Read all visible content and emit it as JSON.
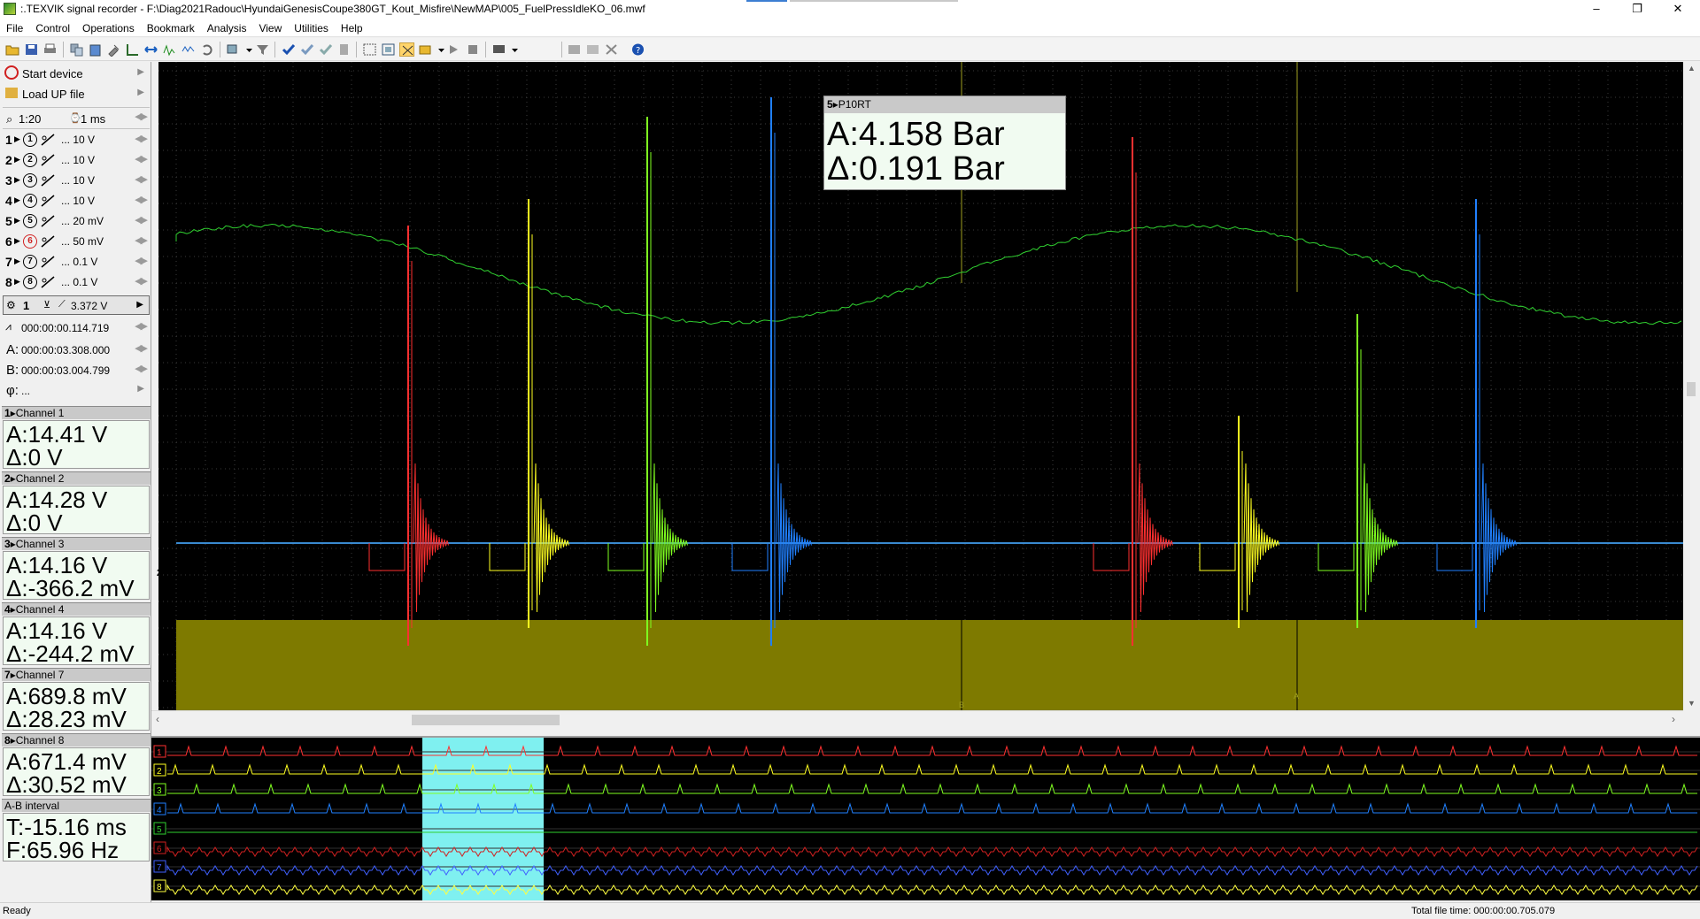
{
  "window": {
    "title": ":.TEXVIK  signal recorder - F:\\Diag2021Radouc\\HyundaiGenesisCoupe380GT_Kout_Misfire\\NewMAP\\005_FuelPressIdleKO_06.mwf",
    "minimize": "–",
    "restore": "❐",
    "close": "✕"
  },
  "menu": [
    "File",
    "Control",
    "Operations",
    "Bookmark",
    "Analysis",
    "View",
    "Utilities",
    "Help"
  ],
  "left": {
    "start_device": "Start device",
    "load_up_file": "Load UP file",
    "zoom": "1:20",
    "timebase": "1 ms",
    "channels": [
      {
        "num": "1",
        "circle": "1",
        "range": "... 10 V",
        "disabled": false
      },
      {
        "num": "2",
        "circle": "2",
        "range": "... 10 V",
        "disabled": false
      },
      {
        "num": "3",
        "circle": "3",
        "range": "... 10 V",
        "disabled": false
      },
      {
        "num": "4",
        "circle": "4",
        "range": "... 10 V",
        "disabled": false
      },
      {
        "num": "5",
        "circle": "5",
        "range": "... 20 mV",
        "disabled": false
      },
      {
        "num": "6",
        "circle": "6",
        "range": "... 50 mV",
        "disabled": true
      },
      {
        "num": "7",
        "circle": "7",
        "range": "... 0.1 V",
        "disabled": false
      },
      {
        "num": "8",
        "circle": "8",
        "range": "... 0.1 V",
        "disabled": false
      }
    ],
    "trigger": {
      "channel": "1",
      "level": "3.372 V"
    },
    "pretrigger": "000:00:00.114.719",
    "cursor_a_label": "A:",
    "cursor_a": "000:00:03.308.000",
    "cursor_b_label": "B:",
    "cursor_b": "000:00:03.004.799",
    "phi_label": "φ:",
    "phi": "..."
  },
  "panels": [
    {
      "num": "1",
      "name": "Channel 1",
      "a": "A:14.41 V",
      "d": "Δ:0 V"
    },
    {
      "num": "2",
      "name": "Channel 2",
      "a": "A:14.28 V",
      "d": "Δ:0 V"
    },
    {
      "num": "3",
      "name": "Channel 3",
      "a": "A:14.16 V",
      "d": "Δ:-366.2 mV"
    },
    {
      "num": "4",
      "name": "Channel 4",
      "a": "A:14.16 V",
      "d": "Δ:-244.2 mV"
    },
    {
      "num": "7",
      "name": "Channel 7",
      "a": "A:689.8 mV",
      "d": "Δ:28.23 mV"
    },
    {
      "num": "8",
      "name": "Channel 8",
      "a": "A:671.4 mV",
      "d": "Δ:30.52 mV"
    },
    {
      "num": "",
      "name": "A-B interval",
      "a": "T:-15.16 ms",
      "d": "F:65.96 Hz"
    }
  ],
  "tooltip": {
    "channel": "5",
    "name": "P10RT",
    "a": "A:4.158 Bar",
    "d": "Δ:0.191 Bar"
  },
  "scope": {
    "marker_label": "2",
    "cursor_a_tag": "A",
    "cursor_b_tag": "B",
    "colors": {
      "ch1": "#ff3030",
      "ch2": "#ffff20",
      "ch3": "#80ff20",
      "ch4": "#2080ff",
      "ch5": "#30d030",
      "ch7": "#2060ff",
      "ch8": "#ffff40",
      "fill": "#7e7a00",
      "grid": "#3a3a3a",
      "cursor": "#a0a020"
    }
  },
  "overview": {
    "labels": [
      "1",
      "2",
      "3",
      "4",
      "5",
      "6",
      "7",
      "8"
    ],
    "selection_color": "#7ff0f0"
  },
  "status": {
    "left": "Ready",
    "right": "Total file time: 000:00:00.705.079"
  }
}
